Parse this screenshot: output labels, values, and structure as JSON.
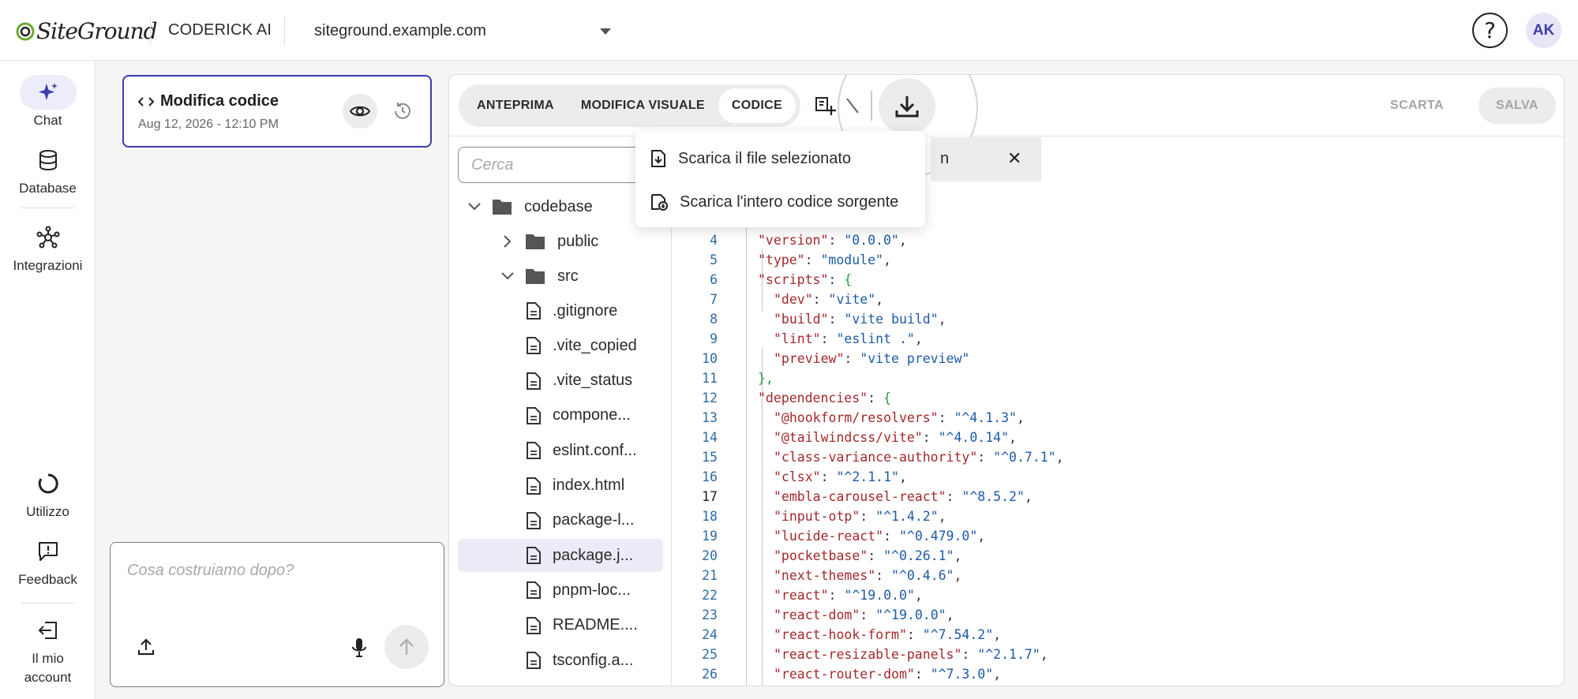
{
  "header": {
    "logo_text": "SiteGround",
    "brand": "CODERICK AI",
    "site": "siteground.example.com",
    "help_label": "?",
    "avatar_initials": "AK"
  },
  "rail": {
    "chat": "Chat",
    "database": "Database",
    "integrations": "Integrazioni",
    "usage": "Utilizzo",
    "feedback": "Feedback",
    "account": "Il mio account"
  },
  "version_card": {
    "title": "Modifica codice",
    "date": "Aug 12, 2026 - 12:10 PM"
  },
  "prompt": {
    "placeholder": "Cosa costruiamo dopo?"
  },
  "toolbar": {
    "tabs": [
      "ANTEPRIMA",
      "MODIFICA VISUALE",
      "CODICE"
    ],
    "active_tab": "CODICE",
    "discard": "SCARTA",
    "save": "SALVA"
  },
  "download_menu": {
    "items": [
      "Scarica il file selezionato",
      "Scarica l'intero codice sorgente"
    ]
  },
  "tree": {
    "search_placeholder": "Cerca",
    "root": "codebase",
    "folders": [
      "public",
      "src"
    ],
    "files": [
      ".gitignore",
      ".vite_copied",
      ".vite_status",
      "compone...",
      "eslint.conf...",
      "index.html",
      "package-l...",
      "package.j...",
      "pnpm-loc...",
      "README....",
      "tsconfig.a..."
    ],
    "selected": "package.j..."
  },
  "open_tab": {
    "name": "n",
    "close": "✕"
  },
  "code": {
    "current_line": 17,
    "lines": [
      {
        "n": 4,
        "key": "\"version\"",
        "val": "\"0.0.0\"",
        "end": ","
      },
      {
        "n": 5,
        "key": "\"type\"",
        "val": "\"module\"",
        "end": ","
      },
      {
        "n": 6,
        "key": "\"scripts\"",
        "val": "",
        "end": "{"
      },
      {
        "n": 7,
        "key": "\"dev\"",
        "val": "\"vite\"",
        "end": ","
      },
      {
        "n": 8,
        "key": "\"build\"",
        "val": "\"vite build\"",
        "end": ","
      },
      {
        "n": 9,
        "key": "\"lint\"",
        "val": "\"eslint .\"",
        "end": ","
      },
      {
        "n": 10,
        "key": "\"preview\"",
        "val": "\"vite preview\"",
        "end": ""
      },
      {
        "n": 11,
        "key": "",
        "val": "",
        "end": "},"
      },
      {
        "n": 12,
        "key": "\"dependencies\"",
        "val": "",
        "end": "{"
      },
      {
        "n": 13,
        "key": "\"@hookform/resolvers\"",
        "val": "\"^4.1.3\"",
        "end": ","
      },
      {
        "n": 14,
        "key": "\"@tailwindcss/vite\"",
        "val": "\"^4.0.14\"",
        "end": ","
      },
      {
        "n": 15,
        "key": "\"class-variance-authority\"",
        "val": "\"^0.7.1\"",
        "end": ","
      },
      {
        "n": 16,
        "key": "\"clsx\"",
        "val": "\"^2.1.1\"",
        "end": ","
      },
      {
        "n": 17,
        "key": "\"embla-carousel-react\"",
        "val": "\"^8.5.2\"",
        "end": ","
      },
      {
        "n": 18,
        "key": "\"input-otp\"",
        "val": "\"^1.4.2\"",
        "end": ","
      },
      {
        "n": 19,
        "key": "\"lucide-react\"",
        "val": "\"^0.479.0\"",
        "end": ","
      },
      {
        "n": 20,
        "key": "\"pocketbase\"",
        "val": "\"^0.26.1\"",
        "end": ","
      },
      {
        "n": 21,
        "key": "\"next-themes\"",
        "val": "\"^0.4.6\"",
        "end": ","
      },
      {
        "n": 22,
        "key": "\"react\"",
        "val": "\"^19.0.0\"",
        "end": ","
      },
      {
        "n": 23,
        "key": "\"react-dom\"",
        "val": "\"^19.0.0\"",
        "end": ","
      },
      {
        "n": 24,
        "key": "\"react-hook-form\"",
        "val": "\"^7.54.2\"",
        "end": ","
      },
      {
        "n": 25,
        "key": "\"react-resizable-panels\"",
        "val": "\"^2.1.7\"",
        "end": ","
      },
      {
        "n": 26,
        "key": "\"react-router-dom\"",
        "val": "\"^7.3.0\"",
        "end": ","
      }
    ]
  },
  "colors": {
    "accent": "#3c3cb0",
    "json_key": "#a3282b",
    "json_string": "#1d5aa8",
    "line_number": "#2d6ca2"
  }
}
